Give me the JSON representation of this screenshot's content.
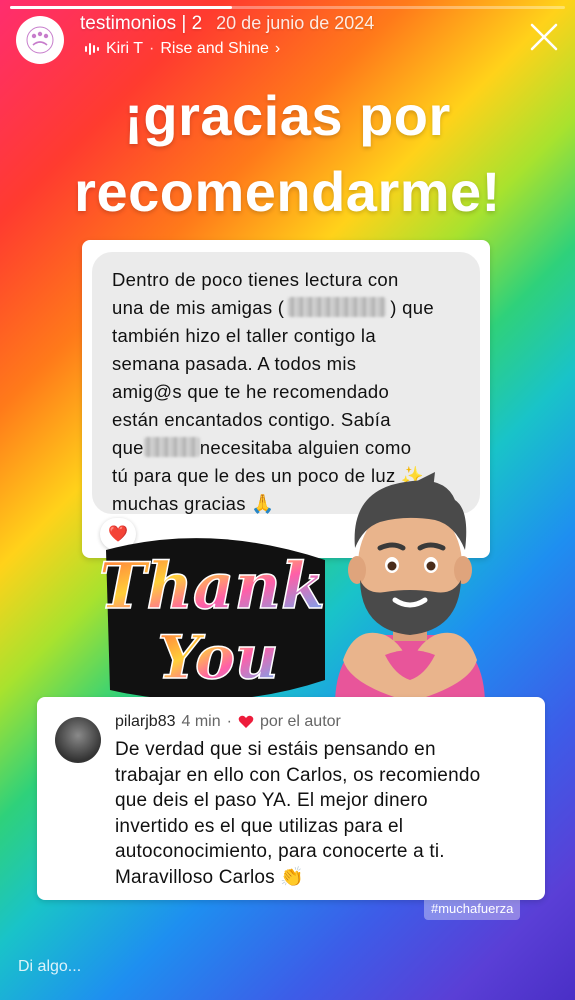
{
  "story": {
    "progress": 0.4,
    "account_name": "testimonios | 2",
    "date": "20 de junio de 2024",
    "music_artist": "Kiri T",
    "music_separator": "·",
    "music_song": "Rise and Shine",
    "music_chevron": "›",
    "close_icon": "close-icon"
  },
  "headline": {
    "line1": "¡gracias por",
    "line2": "recomendarme!"
  },
  "message": {
    "l1": "Dentro de poco tienes lectura con",
    "l2a": "una de mis amigas (",
    "l2b": ") que",
    "l3": "también hizo el taller contigo la",
    "l4": "semana pasada. A todos mis",
    "l5": "amig@s que te he recomendado",
    "l6": "están encantados contigo. Sabía",
    "l7a": "que",
    "l7b": "necesitaba alguien como",
    "l8": "tú para que le des un poco de luz ✨",
    "l9": "muchas gracias 🙏",
    "reaction": "❤️"
  },
  "stickers": {
    "thank": "Thank",
    "you": "You"
  },
  "comment": {
    "username": "pilarjb83",
    "time": "4 min",
    "separator": "·",
    "liked_label": "por el autor",
    "lines": [
      "De verdad que si estáis pensando en",
      "trabajar en ello con Carlos, os recomiendo",
      "que deis el paso YA. El mejor dinero",
      "invertido es el que utilizas para el",
      "autoconocimiento, para conocerte a ti.",
      "Maravilloso Carlos 👏"
    ]
  },
  "hashtag": "#muchafuerza",
  "reply": {
    "placeholder": "Di algo..."
  },
  "colors": {
    "heart": "#ed1c3b",
    "skin": "#e9b48c",
    "shirt": "#e8559a",
    "hair": "#4a4a4a"
  }
}
